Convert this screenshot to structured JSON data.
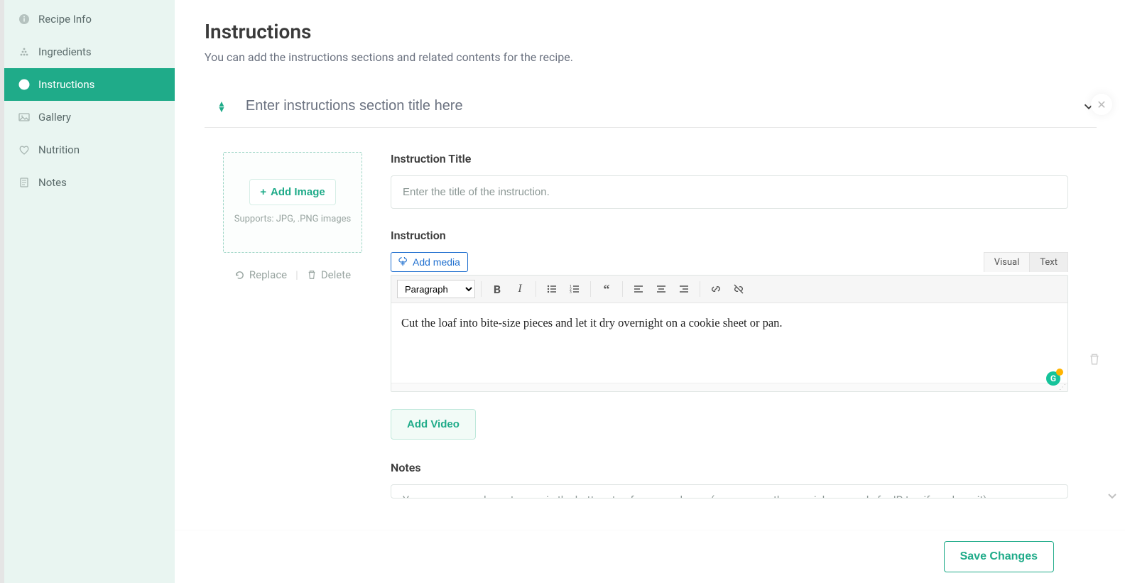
{
  "sidebar": {
    "items": [
      {
        "label": "Recipe Info"
      },
      {
        "label": "Ingredients"
      },
      {
        "label": "Instructions"
      },
      {
        "label": "Gallery"
      },
      {
        "label": "Nutrition"
      },
      {
        "label": "Notes"
      }
    ]
  },
  "header": {
    "title": "Instructions",
    "subtitle": "You can add the instructions sections and related contents for the recipe."
  },
  "section": {
    "title_placeholder": "Enter instructions section title here"
  },
  "image_panel": {
    "add_label": "Add Image",
    "hint": "Supports: JPG, .PNG images",
    "replace": "Replace",
    "delete": "Delete"
  },
  "fields": {
    "title_label": "Instruction Title",
    "title_placeholder": "Enter the title of the instruction.",
    "instruction_label": "Instruction",
    "add_media": "Add media",
    "visual_tab": "Visual",
    "text_tab": "Text",
    "format_select": "Paragraph",
    "content": "Cut the loaf into bite-size pieces and let it dry overnight on a cookie sheet or pan.",
    "add_video": "Add Video",
    "notes_label": "Notes",
    "notes_preview": "You can use parchment paper in the bottom too for easy release. (you can use the special pan made for IP too if you have it)"
  },
  "footer": {
    "save": "Save Changes"
  }
}
